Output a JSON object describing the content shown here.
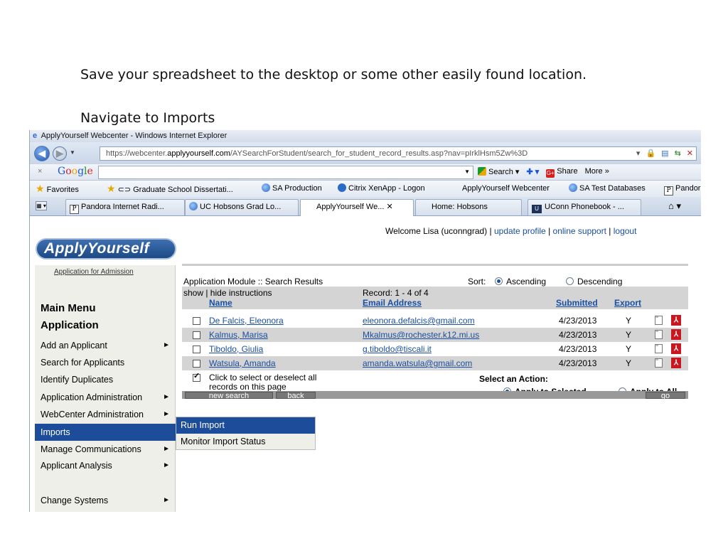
{
  "slide": {
    "line1": "Save your spreadsheet to the desktop or some other easily found location.",
    "line2": "Navigate to Imports"
  },
  "browser": {
    "title": "ApplyYourself Webcenter - Windows Internet Explorer",
    "url_prefix": "https://webcenter.",
    "url_domain": "applyyourself.com",
    "url_path": "/AYSearchForStudent/search_for_student_record_results.asp?nav=pIrklHsm5Zw%3D",
    "google": {
      "close": "×",
      "logo": [
        "G",
        "o",
        "o",
        "g",
        "l",
        "e"
      ],
      "search_label": "Search",
      "share_label": "Share",
      "more_label": "More »"
    },
    "favorites": [
      {
        "label": "Favorites"
      },
      {
        "label": "Graduate School Dissertati..."
      },
      {
        "label": "SA Production"
      },
      {
        "label": "Citrix XenApp - Logon"
      },
      {
        "label": "ApplyYourself Webcenter"
      },
      {
        "label": "SA Test Databases"
      },
      {
        "label": "Pandora"
      }
    ],
    "tabs": [
      {
        "label": "Pandora Internet Radi..."
      },
      {
        "label": "UC Hobsons Grad Lo..."
      },
      {
        "label": "ApplyYourself We...  ✕"
      },
      {
        "label": "Home: Hobsons"
      },
      {
        "label": "UConn Phonebook - ..."
      }
    ]
  },
  "page": {
    "logo": "ApplyYourself",
    "welcome": "Welcome Lisa (uconngrad) |",
    "links": [
      "update profile",
      "online support",
      "logout"
    ],
    "sep": "|",
    "sidebar": {
      "app_for_admission": "Application for Admission",
      "main_menu": "Main Menu",
      "application": "Application",
      "items": [
        {
          "label": "Add an Applicant",
          "arrow": "►"
        },
        {
          "label": "Search for Applicants",
          "arrow": ""
        },
        {
          "label": "Identify Duplicates",
          "arrow": ""
        },
        {
          "label": "Application Administration",
          "arrow": "►"
        },
        {
          "label": "WebCenter Administration",
          "arrow": "►"
        },
        {
          "label": "Imports",
          "arrow": ""
        },
        {
          "label": "Manage Communications",
          "arrow": "►"
        },
        {
          "label": "Applicant Analysis",
          "arrow": "►"
        },
        {
          "label": "Change Systems",
          "arrow": "►"
        }
      ]
    },
    "popup": {
      "items": [
        "Run Import",
        "Monitor Import Status"
      ]
    },
    "results": {
      "module_title": "Application Module :: Search Results",
      "sort_label": "Sort:",
      "ascending": "Ascending",
      "descending": "Descending",
      "instructions": "show | hide instructions",
      "record": "Record: 1 - 4 of 4",
      "columns": {
        "name": "Name",
        "email": "Email Address",
        "submitted": "Submitted",
        "export": "Export"
      },
      "rows": [
        {
          "name": "De Falcis, Eleonora",
          "email": "eleonora.defalcis@gmail.com",
          "submitted": "4/23/2013",
          "export": "Y"
        },
        {
          "name": "Kalmus, Marisa",
          "email": "Mkalmus@rochester.k12.mi.us",
          "submitted": "4/23/2013",
          "export": "Y"
        },
        {
          "name": "Tiboldo, Giulia",
          "email": "g.tiboldo@tiscali.it",
          "submitted": "4/23/2013",
          "export": "Y"
        },
        {
          "name": "Watsula, Amanda",
          "email": "amanda.watsula@gmail.com",
          "submitted": "4/23/2013",
          "export": "Y"
        }
      ],
      "select_all_line1": "Click to select or deselect all",
      "select_all_line2": "records on this page",
      "select_action": "Select an Action:",
      "apply_selected": "Apply to Selected",
      "apply_all": "Apply to All",
      "new_search": "new search",
      "back": "back",
      "go": "go"
    }
  }
}
